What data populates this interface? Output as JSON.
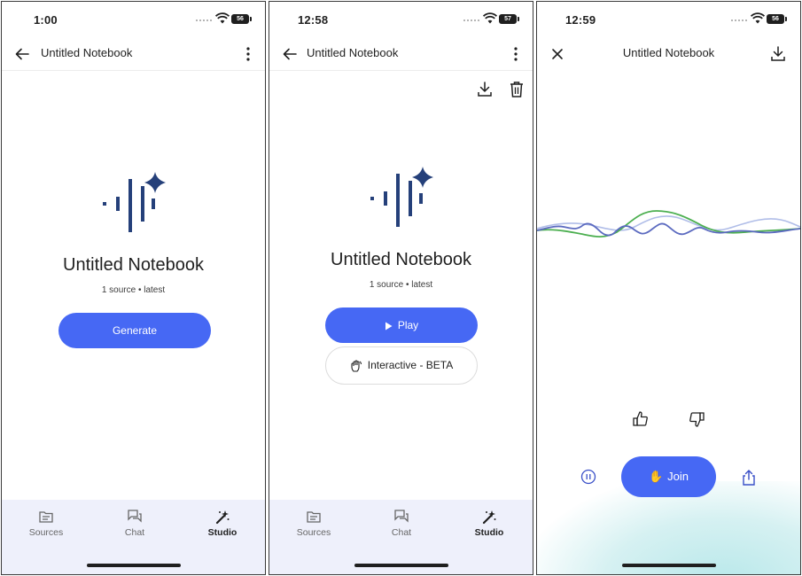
{
  "screens": [
    {
      "status": {
        "time": "1:00",
        "battery": "56"
      },
      "appbar": {
        "title": "Untitled Notebook"
      },
      "notebook": {
        "title": "Untitled Notebook",
        "subtitle": "1 source • latest"
      },
      "primary_button": "Generate",
      "nav": [
        {
          "label": "Sources",
          "icon": "sources-icon"
        },
        {
          "label": "Chat",
          "icon": "chat-icon"
        },
        {
          "label": "Studio",
          "icon": "studio-icon",
          "active": true
        }
      ]
    },
    {
      "status": {
        "time": "12:58",
        "battery": "57"
      },
      "appbar": {
        "title": "Untitled Notebook"
      },
      "notebook": {
        "title": "Untitled Notebook",
        "subtitle": "1 source • latest"
      },
      "play_button": "Play",
      "interactive_button": "Interactive - BETA",
      "nav": [
        {
          "label": "Sources",
          "icon": "sources-icon"
        },
        {
          "label": "Chat",
          "icon": "chat-icon"
        },
        {
          "label": "Studio",
          "icon": "studio-icon",
          "active": true
        }
      ]
    },
    {
      "status": {
        "time": "12:59",
        "battery": "56"
      },
      "appbar": {
        "title": "Untitled Notebook"
      },
      "join_button": "Join",
      "waveform_colors": [
        "#4caf50",
        "#5c6bc0",
        "#b0bde8"
      ]
    }
  ],
  "colors": {
    "accent": "#4668f4",
    "logo": "#25407a",
    "nav_bg": "#eef0fb"
  }
}
